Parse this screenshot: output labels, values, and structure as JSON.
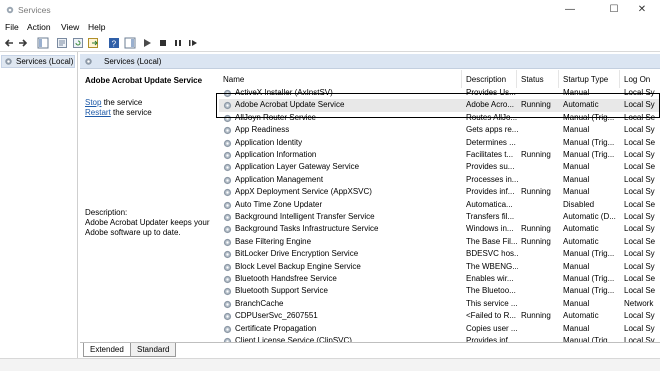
{
  "window": {
    "title": "Services",
    "minimize": "—",
    "maximize": "☐",
    "close": "✕"
  },
  "menu": [
    "File",
    "Action",
    "View",
    "Help"
  ],
  "tree": {
    "root_label": "Services (Local)"
  },
  "header": {
    "label": "Services (Local)"
  },
  "details": {
    "service_name": "Adobe Acrobat Update Service",
    "stop_link": "Stop",
    "stop_suffix": " the service",
    "restart_link": "Restart",
    "restart_suffix": " the service",
    "description_label": "Description:",
    "description_text": "Adobe Acrobat Updater keeps your Adobe software up to date."
  },
  "columns": {
    "name": "Name",
    "description": "Description",
    "status": "Status",
    "startup": "Startup Type",
    "logon": "Log On"
  },
  "rows": [
    {
      "name": "ActiveX Installer (AxInstSV)",
      "desc": "Provides Us...",
      "status": "",
      "startup": "Manual",
      "logon": "Local Sy"
    },
    {
      "name": "Adobe Acrobat Update Service",
      "desc": "Adobe Acro...",
      "status": "Running",
      "startup": "Automatic",
      "logon": "Local Sy"
    },
    {
      "name": "AllJoyn Router Service",
      "desc": "Routes AllJo...",
      "status": "",
      "startup": "Manual (Trig...",
      "logon": "Local Se"
    },
    {
      "name": "App Readiness",
      "desc": "Gets apps re...",
      "status": "",
      "startup": "Manual",
      "logon": "Local Sy"
    },
    {
      "name": "Application Identity",
      "desc": "Determines ...",
      "status": "",
      "startup": "Manual (Trig...",
      "logon": "Local Se"
    },
    {
      "name": "Application Information",
      "desc": "Facilitates t...",
      "status": "Running",
      "startup": "Manual (Trig...",
      "logon": "Local Sy"
    },
    {
      "name": "Application Layer Gateway Service",
      "desc": "Provides su...",
      "status": "",
      "startup": "Manual",
      "logon": "Local Se"
    },
    {
      "name": "Application Management",
      "desc": "Processes in...",
      "status": "",
      "startup": "Manual",
      "logon": "Local Sy"
    },
    {
      "name": "AppX Deployment Service (AppXSVC)",
      "desc": "Provides inf...",
      "status": "Running",
      "startup": "Manual",
      "logon": "Local Sy"
    },
    {
      "name": "Auto Time Zone Updater",
      "desc": "Automatica...",
      "status": "",
      "startup": "Disabled",
      "logon": "Local Se"
    },
    {
      "name": "Background Intelligent Transfer Service",
      "desc": "Transfers fil...",
      "status": "",
      "startup": "Automatic (D...",
      "logon": "Local Sy"
    },
    {
      "name": "Background Tasks Infrastructure Service",
      "desc": "Windows in...",
      "status": "Running",
      "startup": "Automatic",
      "logon": "Local Sy"
    },
    {
      "name": "Base Filtering Engine",
      "desc": "The Base Fil...",
      "status": "Running",
      "startup": "Automatic",
      "logon": "Local Se"
    },
    {
      "name": "BitLocker Drive Encryption Service",
      "desc": "BDESVC hos...",
      "status": "",
      "startup": "Manual (Trig...",
      "logon": "Local Sy"
    },
    {
      "name": "Block Level Backup Engine Service",
      "desc": "The WBENG...",
      "status": "",
      "startup": "Manual",
      "logon": "Local Sy"
    },
    {
      "name": "Bluetooth Handsfree Service",
      "desc": "Enables wir...",
      "status": "",
      "startup": "Manual (Trig...",
      "logon": "Local Se"
    },
    {
      "name": "Bluetooth Support Service",
      "desc": "The Bluetoo...",
      "status": "",
      "startup": "Manual (Trig...",
      "logon": "Local Se"
    },
    {
      "name": "BranchCache",
      "desc": "This service ...",
      "status": "",
      "startup": "Manual",
      "logon": "Network"
    },
    {
      "name": "CDPUserSvc_2607551",
      "desc": "<Failed to R...",
      "status": "Running",
      "startup": "Automatic",
      "logon": "Local Sy"
    },
    {
      "name": "Certificate Propagation",
      "desc": "Copies user ...",
      "status": "",
      "startup": "Manual",
      "logon": "Local Sy"
    },
    {
      "name": "Client License Service (ClipSVC)",
      "desc": "Provides inf...",
      "status": "",
      "startup": "Manual (Trig...",
      "logon": "Local Sy"
    }
  ],
  "tabs": {
    "extended": "Extended",
    "standard": "Standard"
  },
  "colors": {
    "header_band": "#dbe5f2",
    "link": "#1e5aa8",
    "selected_row": "#e8e8e8"
  }
}
